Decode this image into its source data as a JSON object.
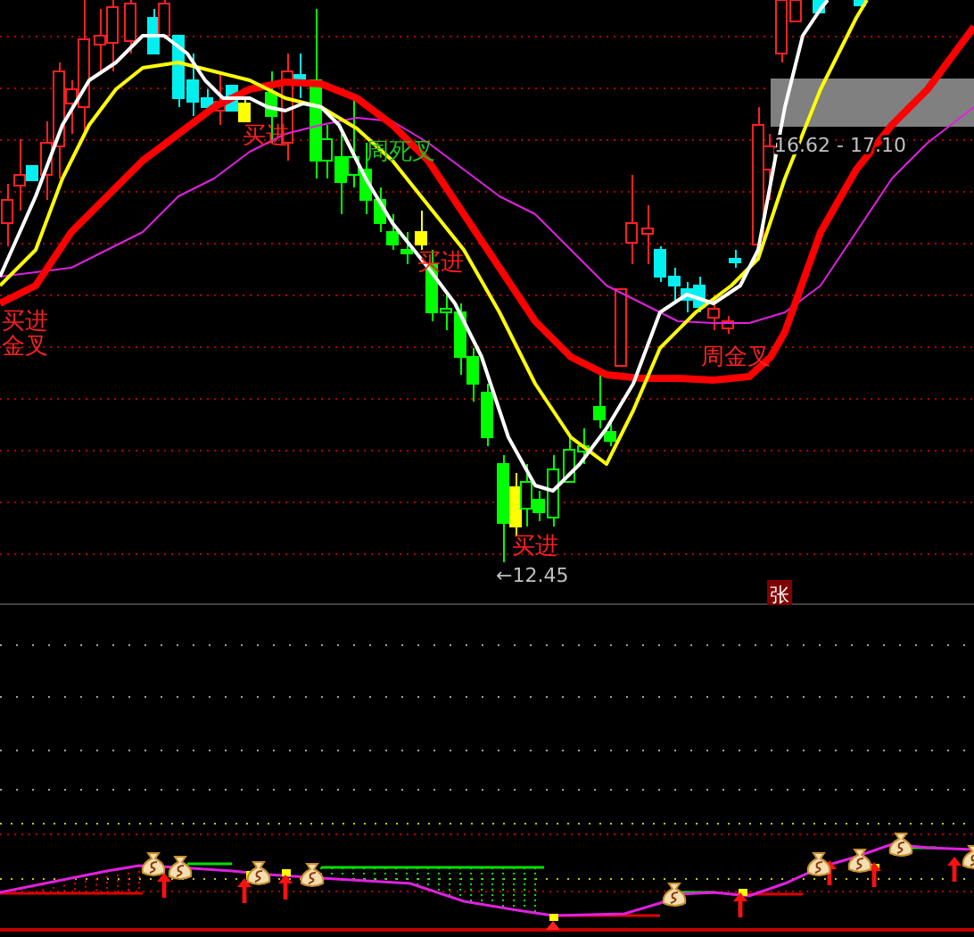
{
  "signals": [
    {
      "text": "买进",
      "color": "#ff2020"
    },
    {
      "text": "周死叉",
      "color": "#20c020"
    },
    {
      "text": "买进",
      "color": "#ff2020"
    },
    {
      "text": "买进",
      "color": "#ff2020"
    },
    {
      "text": "金叉",
      "color": "#ff2020"
    },
    {
      "text": "周金叉",
      "color": "#ff2020"
    },
    {
      "text": "买进",
      "color": "#ff2020"
    }
  ],
  "low_marker": "←12.45",
  "price_range": "16.62 - 17.10",
  "badge": "张"
}
